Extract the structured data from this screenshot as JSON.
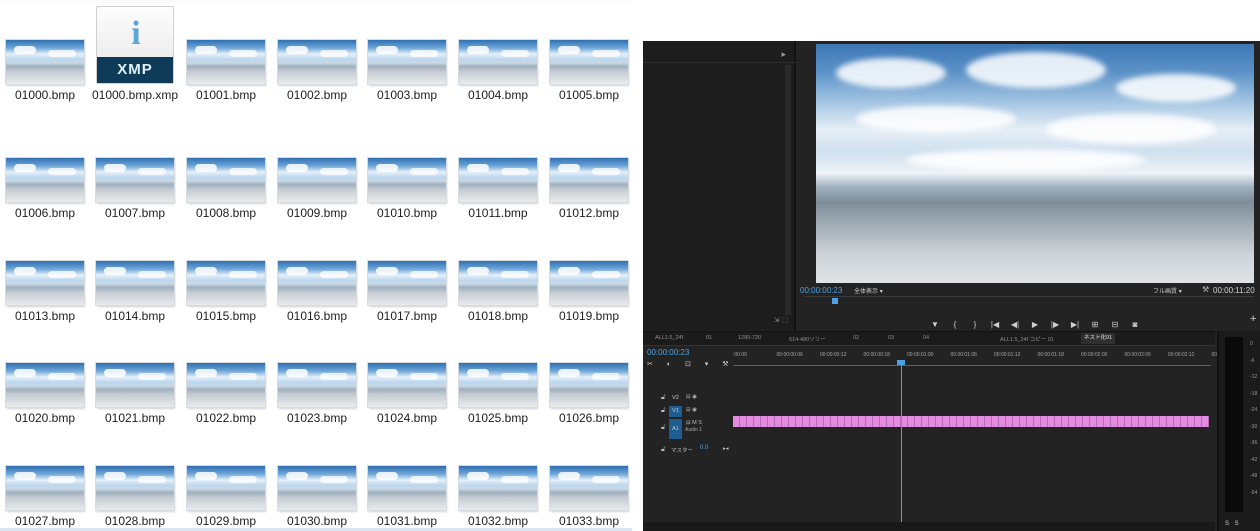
{
  "explorer": {
    "xmp_icon": {
      "glyph": "i",
      "label": "XMP"
    },
    "files": [
      "01000.bmp",
      "01000.bmp.xmp",
      "01001.bmp",
      "01002.bmp",
      "01003.bmp",
      "01004.bmp",
      "01005.bmp",
      "01006.bmp",
      "01007.bmp",
      "01008.bmp",
      "01009.bmp",
      "01010.bmp",
      "01011.bmp",
      "01012.bmp",
      "01013.bmp",
      "01014.bmp",
      "01015.bmp",
      "01016.bmp",
      "01017.bmp",
      "01018.bmp",
      "01019.bmp",
      "01020.bmp",
      "01021.bmp",
      "01022.bmp",
      "01023.bmp",
      "01024.bmp",
      "01025.bmp",
      "01026.bmp",
      "01027.bmp",
      "01028.bmp",
      "01029.bmp",
      "01030.bmp",
      "01031.bmp",
      "01032.bmp",
      "01033.bmp"
    ]
  },
  "premiere": {
    "monitor": {
      "timecode_current": "00:00:00:23",
      "fit_label": "全体表示",
      "quality_label": "フル画質",
      "timecode_duration": "00:00:11:20",
      "transport": [
        "▼",
        "{",
        "}",
        "|◀",
        "◀|",
        "▶",
        "|▶",
        "▶|",
        "⊞",
        "⊟",
        "◙"
      ]
    },
    "timeline": {
      "tabs": [
        "ALL1.5_24f",
        "01",
        "1280-720",
        "614-480ソリー",
        "02",
        "03",
        "04",
        "ALL1.5_24f コピー 01",
        "ネスト化01"
      ],
      "active_tab": "ネスト化01",
      "timecode": "00:00:00:23",
      "ruler_ticks": [
        ":00:00",
        "00:00:00:06",
        "00:00:00:12",
        "00:00:00:18",
        "00:00:01:00",
        "00:00:01:06",
        "00:00:01:12",
        "00:00:01:18",
        "00:00:02:00",
        "00:00:02:06",
        "00:00:02:12",
        "00:00:0"
      ],
      "tracks": {
        "v2": "V2",
        "v1": "V1",
        "a1": "A1",
        "a1_sub": "Audio 1",
        "a1_icons": "M S",
        "master": "マスター",
        "master_value": "0.0"
      }
    },
    "meters": {
      "db_labels": [
        "0",
        "-6",
        "-12",
        "-18",
        "-24",
        "-30",
        "-36",
        "-42",
        "-48",
        "-54"
      ],
      "solo": "S S"
    }
  }
}
